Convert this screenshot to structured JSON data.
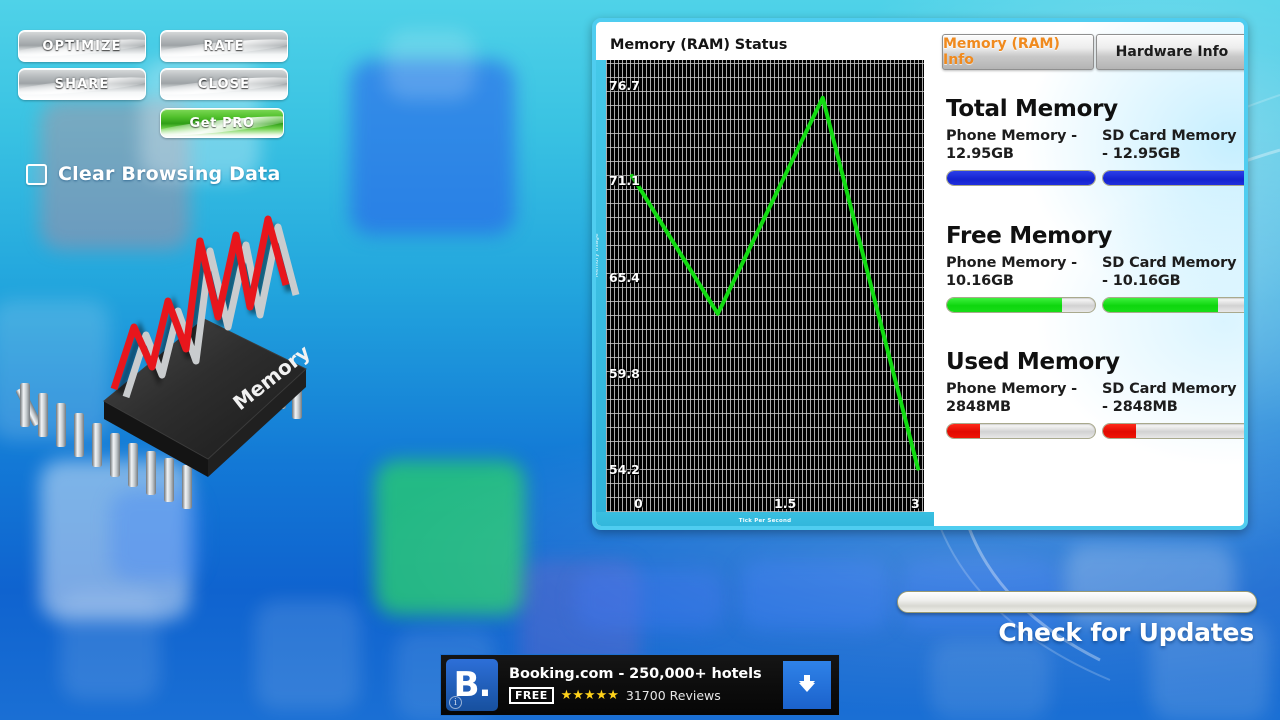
{
  "toolbar": {
    "optimize_label": "OPTIMIZE",
    "rate_label": "RATE",
    "share_label": "SHARE",
    "close_label": "CLOSE",
    "getpro_label": "Get PRO"
  },
  "options": {
    "clear_browsing_data_label": "Clear Browsing Data",
    "clear_browsing_data_checked": "false"
  },
  "illustration": {
    "chip_label": "Memory"
  },
  "card": {
    "chart_title": "Memory (RAM) Status",
    "tabs": [
      {
        "label": "Memory (RAM) Info",
        "active": "true"
      },
      {
        "label": "Hardware Info",
        "active": "false"
      }
    ],
    "sections": [
      {
        "heading": "Total Memory",
        "left_label": "Phone Memory -",
        "left_value": "12.95GB",
        "right_label": "SD Card Memory",
        "right_value": "- 12.95GB",
        "bar_color": "#1f2fd6",
        "bar_percent": 100
      },
      {
        "heading": "Free Memory",
        "left_label": "Phone Memory -",
        "left_value": "10.16GB",
        "right_label": "SD Card Memory",
        "right_value": "- 10.16GB",
        "bar_color": "#16d916",
        "bar_percent": 78
      },
      {
        "heading": "Used Memory",
        "left_label": "Phone Memory -",
        "left_value": "2848MB",
        "right_label": "SD Card Memory",
        "right_value": "- 2848MB",
        "bar_color": "#ed1100",
        "bar_percent": 22
      }
    ]
  },
  "chart_data": {
    "type": "line",
    "title": "Memory (RAM) Status",
    "xlabel": "Tick Per Second",
    "ylabel": "Memory Usage",
    "x": [
      0,
      0.9,
      2.0,
      3.0
    ],
    "values": [
      72.5,
      63.5,
      77.6,
      53.4
    ],
    "series": [
      {
        "name": "Memory Usage",
        "values": [
          72.5,
          63.5,
          77.6,
          53.4
        ]
      }
    ],
    "xticks": [
      "0",
      "1.5",
      "3"
    ],
    "xtick_values": [
      0,
      1.5,
      3
    ],
    "yticks": [
      "76.7",
      "71.1",
      "65.4",
      "59.8",
      "54.2"
    ],
    "ytick_values": [
      76.7,
      71.1,
      65.4,
      59.8,
      54.2
    ],
    "xlim": [
      0,
      3
    ],
    "ylim": [
      52.0,
      78.5
    ],
    "grid": "true",
    "legend": "none",
    "line_color": "#12dd12",
    "plot_background": "#000000"
  },
  "updates": {
    "label": "Check for Updates",
    "progress_percent": 0
  },
  "ad": {
    "icon_letter": "B.",
    "info_badge": "i",
    "title": "Booking.com - 250,000+ hotels",
    "free_badge": "FREE",
    "stars": "★★★★★",
    "rating": 4.5,
    "reviews": "31700 Reviews",
    "cta_icon": "download-arrow"
  }
}
